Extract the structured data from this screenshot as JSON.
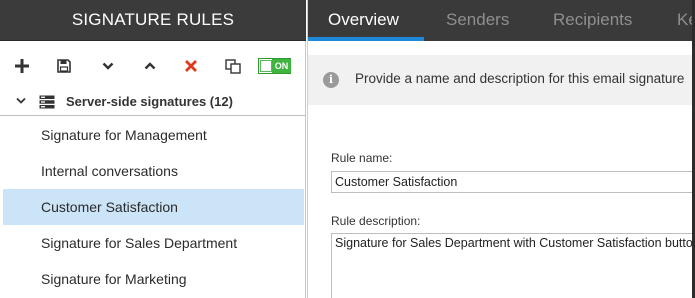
{
  "left_panel": {
    "title": "SIGNATURE RULES",
    "toolbar": {
      "add": "plus-icon",
      "save": "save-icon",
      "move_down": "chevron-down-icon",
      "move_up": "chevron-up-icon",
      "delete": "delete-icon",
      "duplicate": "duplicate-icon",
      "toggle_label": "ON"
    },
    "group": {
      "label": "Server-side signatures (12)"
    },
    "items": [
      {
        "label": "Signature for Management"
      },
      {
        "label": "Internal conversations"
      },
      {
        "label": "Customer Satisfaction",
        "selected": true
      },
      {
        "label": "Signature for Sales Department"
      },
      {
        "label": "Signature for Marketing"
      }
    ]
  },
  "tabs": [
    {
      "label": "Overview",
      "active": true
    },
    {
      "label": "Senders"
    },
    {
      "label": "Recipients"
    },
    {
      "label": "Ke"
    }
  ],
  "info": {
    "icon": "info-icon",
    "text": "Provide a name and description for this email signature"
  },
  "form": {
    "rule_name_label": "Rule name:",
    "rule_name_value": "Customer Satisfaction",
    "rule_description_label": "Rule description:",
    "rule_description_value": "Signature for Sales Department with Customer Satisfaction buttons"
  },
  "colors": {
    "header_bg": "#3b3b3b",
    "accent": "#1e88d9",
    "selected_bg": "#cce4f7",
    "toggle_green": "#3fb43f",
    "delete_red": "#e03a1e"
  }
}
